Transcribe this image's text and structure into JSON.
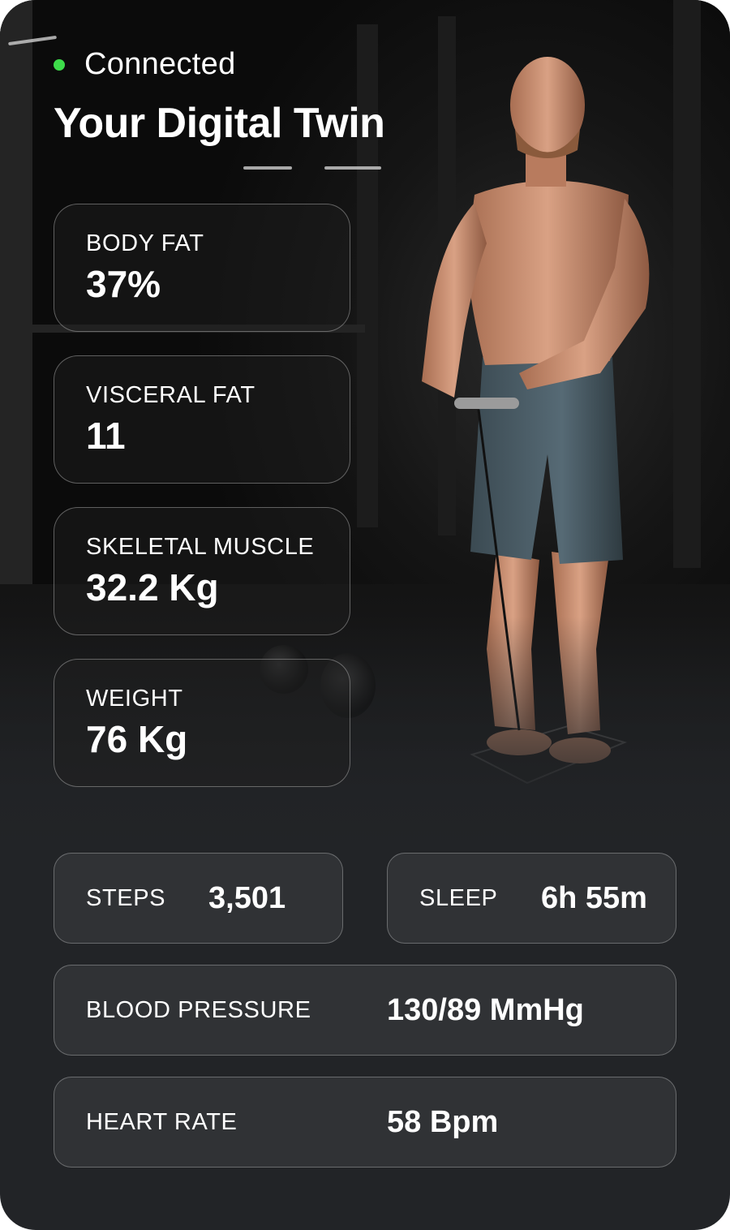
{
  "header": {
    "status_text": "Connected",
    "status_color": "#3ddc4a",
    "title": "Your Digital Twin"
  },
  "body_metrics": [
    {
      "label": "BODY FAT",
      "value": "37%"
    },
    {
      "label": "VISCERAL FAT",
      "value": "11"
    },
    {
      "label": "SKELETAL MUSCLE",
      "value": "32.2 Kg"
    },
    {
      "label": "WEIGHT",
      "value": "76 Kg"
    }
  ],
  "stats": {
    "steps": {
      "label": "STEPS",
      "value": "3,501"
    },
    "sleep": {
      "label": "SLEEP",
      "value": "6h 55m"
    },
    "blood_pressure": {
      "label": "BLOOD PRESSURE",
      "value": "130/89 MmHg"
    },
    "heart_rate": {
      "label": "HEART RATE",
      "value": "58 Bpm"
    }
  },
  "colors": {
    "card_background": "#222427",
    "tile_background": "#303235",
    "text": "#ffffff"
  },
  "photo": {
    "subject": "man-standing-on-smart-scale-in-gym"
  }
}
